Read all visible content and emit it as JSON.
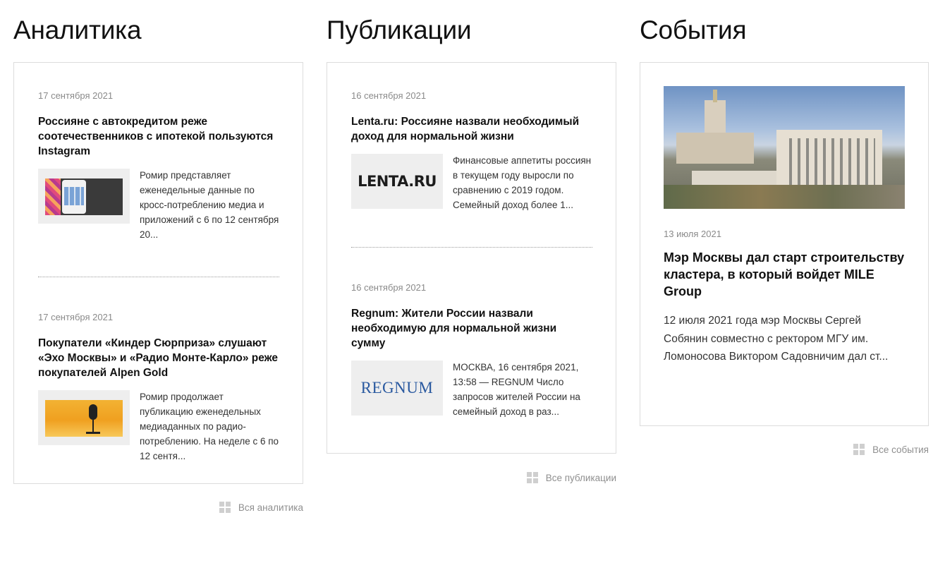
{
  "analytics": {
    "title": "Аналитика",
    "items": [
      {
        "date": "17 сентября 2021",
        "headline": "Россияне с автокредитом реже соотечественников с ипотекой пользуются Instagram",
        "excerpt": "Ромир представляет еженедельные данные по кросс-потреблению медиа и приложений с 6 по 12 сентября 20...",
        "thumb_icon": "instagram-phone-image"
      },
      {
        "date": "17 сентября 2021",
        "headline": "Покупатели «Киндер Сюрприза» слушают «Эхо Москвы» и «Радио Монте-Карло» реже покупателей Alpen Gold",
        "excerpt": "Ромир продолжает публикацию еженедельных медиаданных по радио-потреблению. На неделе с 6 по 12 сентя...",
        "thumb_icon": "microphone-image"
      }
    ],
    "footer_link": "Вся аналитика"
  },
  "publications": {
    "title": "Публикации",
    "items": [
      {
        "date": "16 сентября 2021",
        "headline": "Lenta.ru: Россияне назвали необходимый доход для нормальной жизни",
        "excerpt": "Финансовые аппетиты россиян в текущем году выросли по сравнению с 2019 годом. Семейный доход более 1...",
        "logo_text": "LENTA.RU"
      },
      {
        "date": "16 сентября 2021",
        "headline": "Regnum: Жители России назвали необходимую для нормальной жизни сумму",
        "excerpt": "МОСКВА, 16 сентября 2021, 13:58 — REGNUM Число запросов жителей России на семейный доход в раз...",
        "logo_text": "REGNUM"
      }
    ],
    "footer_link": "Все публикации"
  },
  "events": {
    "title": "События",
    "items": [
      {
        "date": "13 июля 2021",
        "headline": "Мэр Москвы дал старт строительству кластера, в который войдет MILE Group",
        "excerpt": "12 июля 2021 года мэр Москвы Сергей Собянин совместно с ректором МГУ им. Ломоносова Виктором Садовничим дал ст...",
        "photo_icon": "moscow-university-cluster-photo"
      }
    ],
    "footer_link": "Все события"
  },
  "colors": {
    "text": "#111111",
    "muted": "#8a8a8a",
    "border": "#dcdcdc",
    "regnum_blue": "#2b5aa0"
  }
}
